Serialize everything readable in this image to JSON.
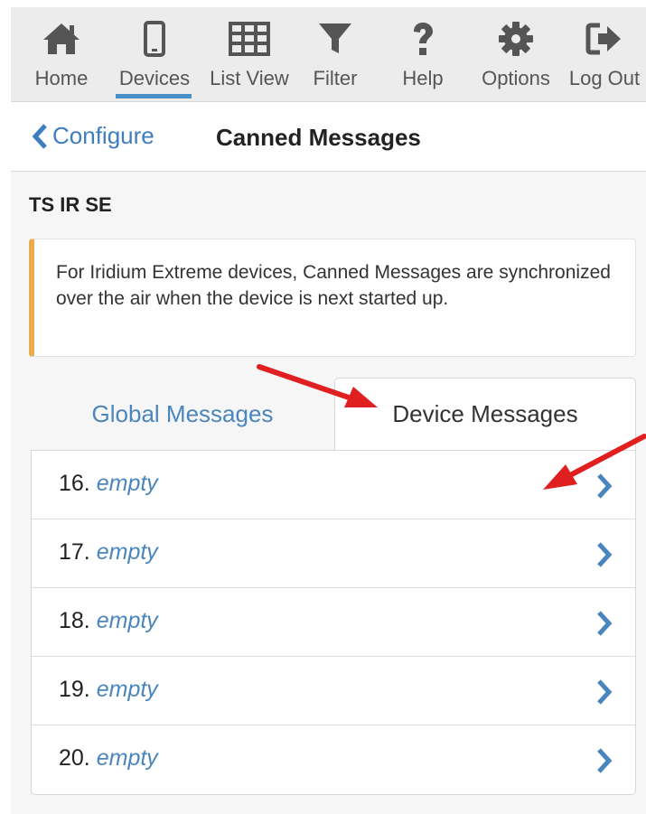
{
  "toolbar": {
    "items": [
      {
        "label": "Home",
        "icon": "home-icon"
      },
      {
        "label": "Devices",
        "icon": "phone-icon",
        "active": true
      },
      {
        "label": "List View",
        "icon": "grid-icon"
      },
      {
        "label": "Filter",
        "icon": "filter-icon"
      },
      {
        "label": "Help",
        "icon": "question-icon"
      },
      {
        "label": "Options",
        "icon": "gear-icon"
      },
      {
        "label": "Log Out",
        "icon": "logout-icon"
      }
    ]
  },
  "header": {
    "back_label": "Configure",
    "title": "Canned Messages"
  },
  "device": {
    "name": "TS IR SE"
  },
  "callout": {
    "text": "For Iridium Extreme devices, Canned Messages are synchronized over the air when the device is next started up."
  },
  "tabs": [
    {
      "label": "Global Messages",
      "active": false
    },
    {
      "label": "Device Messages",
      "active": true
    }
  ],
  "messages": [
    {
      "number": "16.",
      "value": "empty"
    },
    {
      "number": "17.",
      "value": "empty"
    },
    {
      "number": "18.",
      "value": "empty"
    },
    {
      "number": "19.",
      "value": "empty"
    },
    {
      "number": "20.",
      "value": "empty"
    }
  ],
  "colors": {
    "accent": "#4a86bd",
    "underline": "#4a90c8",
    "callout_border": "#e8ad4c",
    "icon": "#555555",
    "annotation_arrow": "#e02020"
  }
}
